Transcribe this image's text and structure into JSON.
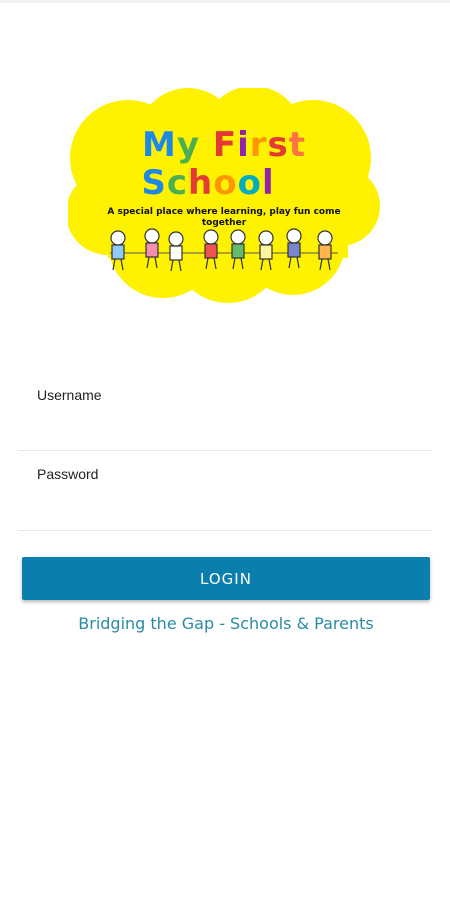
{
  "logo": {
    "title_line1": "My First",
    "title_line2": "School",
    "subtitle_line1": "A special place where learning, play fun come",
    "subtitle_line2": "together",
    "blob_color": "#fef200"
  },
  "form": {
    "username_label": "Username",
    "username_value": "",
    "password_label": "Password",
    "password_value": ""
  },
  "login": {
    "label": "LOGIN",
    "color": "#0a7fae"
  },
  "tagline": "Bridging the Gap - Schools & Parents"
}
